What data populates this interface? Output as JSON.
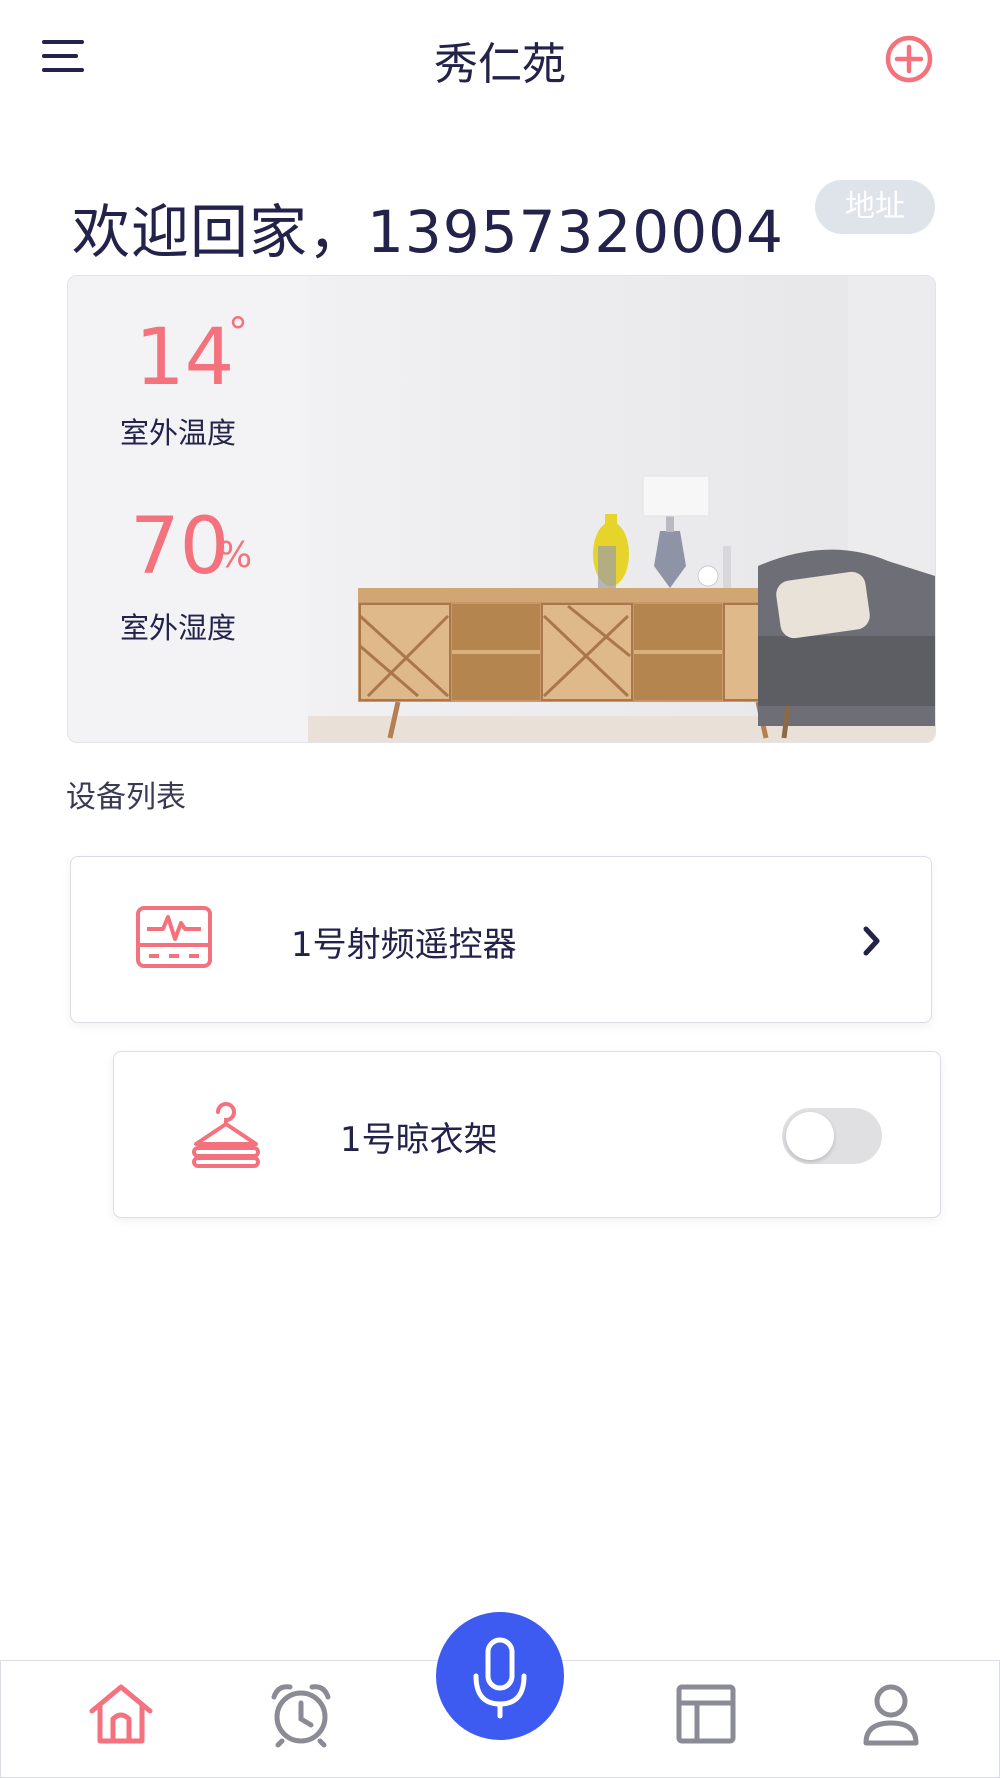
{
  "header": {
    "title": "秀仁苑",
    "menu_icon": "menu-icon",
    "add_icon": "add-circle-icon"
  },
  "welcome": {
    "text": "欢迎回家，13957320004",
    "address_label": "地址"
  },
  "weather": {
    "temperature": {
      "value": "14",
      "unit": "°",
      "label": "室外温度"
    },
    "humidity": {
      "value": "70",
      "unit": "%",
      "label": "室外湿度"
    }
  },
  "devices": {
    "title": "设备列表",
    "items": [
      {
        "name": "1号射频遥控器",
        "icon": "rf-remote-icon",
        "action": "chevron-right-icon"
      },
      {
        "name": "1号晾衣架",
        "icon": "clothes-hanger-icon",
        "toggle_on": false
      }
    ]
  },
  "bottom_nav": {
    "items": [
      {
        "icon": "home-icon",
        "active": true
      },
      {
        "icon": "alarm-clock-icon",
        "active": false
      },
      {
        "icon": "microphone-icon",
        "active": false
      },
      {
        "icon": "layout-icon",
        "active": false
      },
      {
        "icon": "user-icon",
        "active": false
      }
    ]
  },
  "colors": {
    "accent": "#f4727d",
    "primary_text": "#23224a",
    "mic_button": "#3d5af1",
    "badge_bg": "#dfe3ea"
  }
}
